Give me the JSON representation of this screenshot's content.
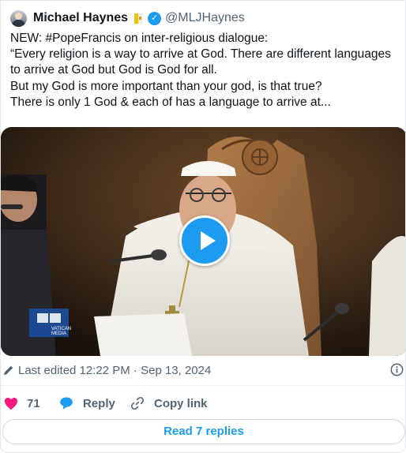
{
  "author": {
    "name": "Michael Haynes",
    "handle": "@MLJHaynes"
  },
  "tweet": {
    "lines": [
      "NEW: #PopeFrancis on inter-religious dialogue:",
      "“Every religion is a way to arrive at God. There are different languages",
      "to arrive at God but God is God for all.",
      "But my God is more important than your god, is that true?",
      "There is only 1 God & each of has a language to arrive at..."
    ]
  },
  "media": {
    "watermark_line1": "VATICAN",
    "watermark_line2": "MEDIA"
  },
  "meta": {
    "edited": "Last edited 12:22 PM · Sep 13, 2024"
  },
  "actions": {
    "like_count": "71",
    "reply_label": "Reply",
    "copy_label": "Copy link"
  },
  "replies_button": "Read 7 replies",
  "colors": {
    "accent": "#1d9bf0",
    "like": "#f91880",
    "secondary_text": "#536471"
  }
}
